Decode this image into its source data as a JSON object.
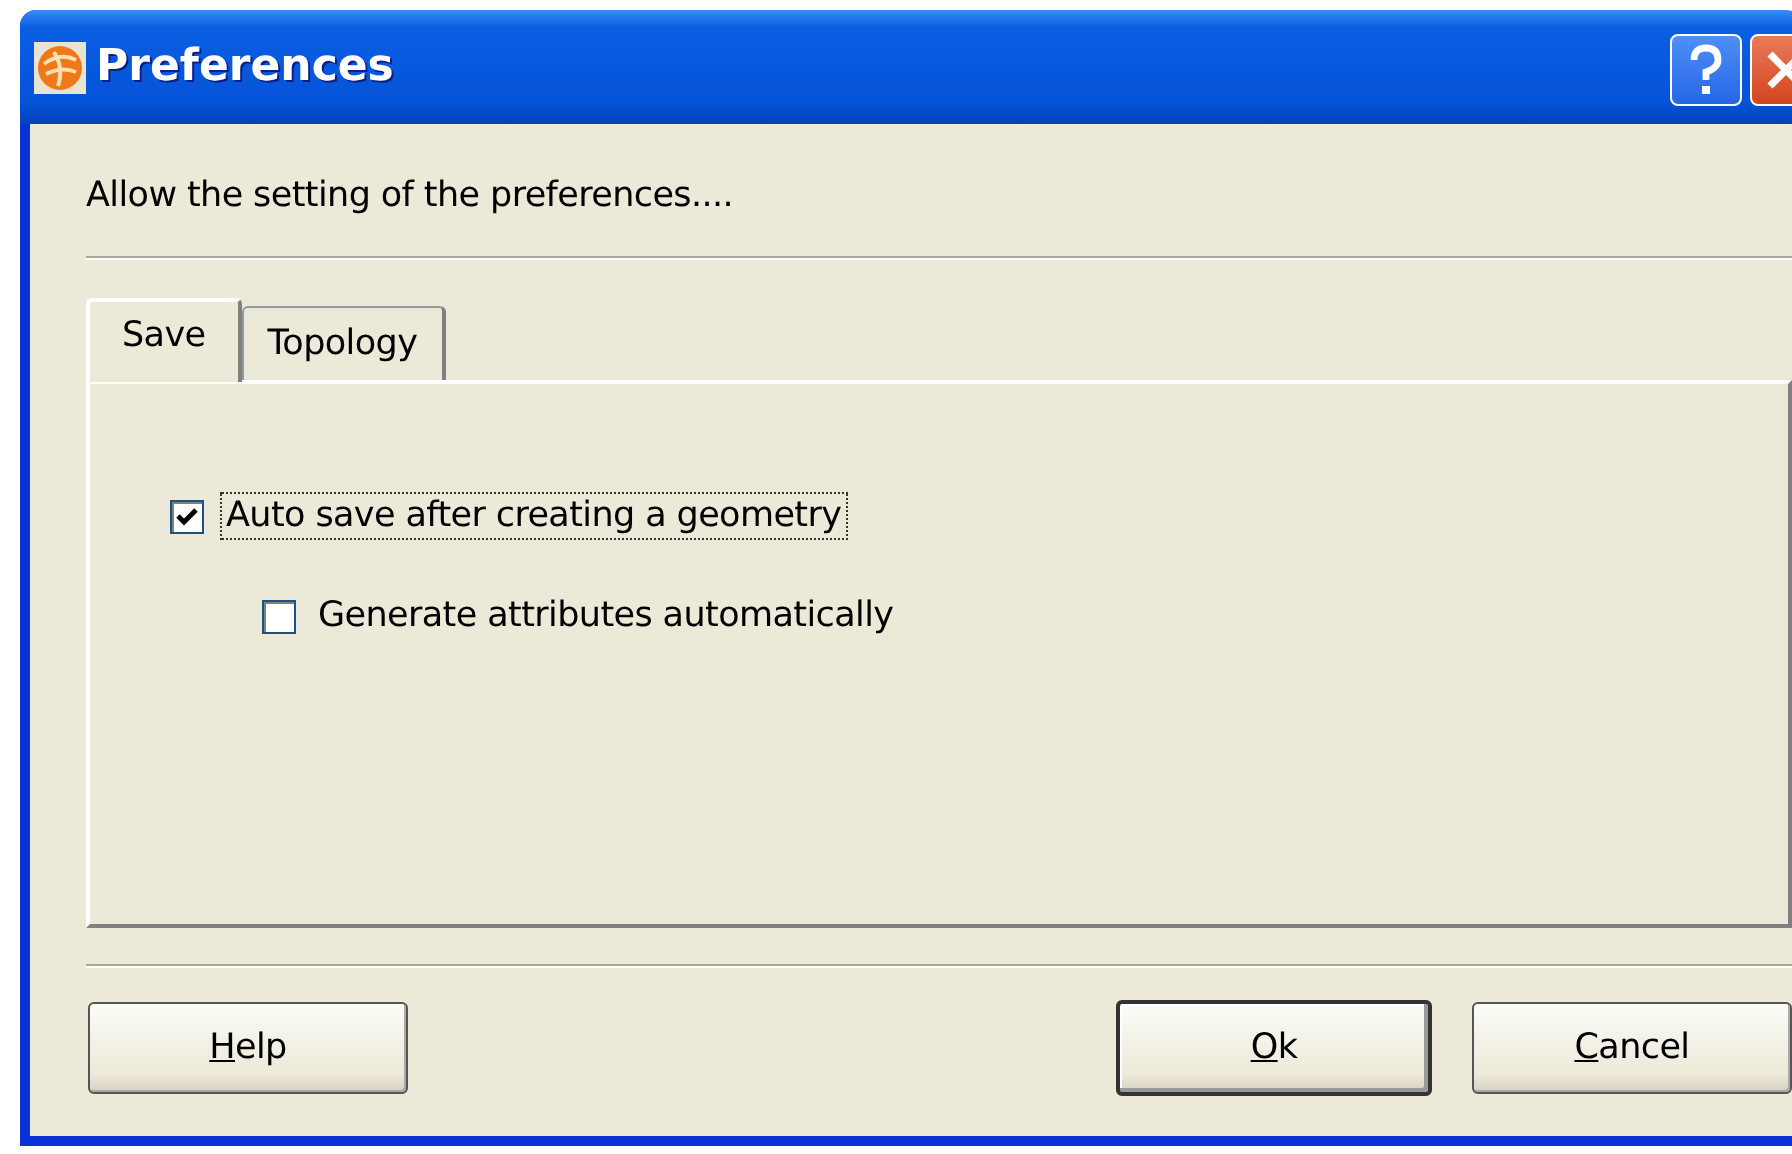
{
  "window": {
    "title": "Preferences"
  },
  "description": "Allow the setting of the preferences....",
  "tabs": [
    {
      "label": "Save",
      "selected": true
    },
    {
      "label": "Topology",
      "selected": false
    }
  ],
  "options": [
    {
      "label": "Auto save after creating a geometry",
      "checked": true,
      "focused": true,
      "children": [
        {
          "label": "Generate attributes automatically",
          "checked": false,
          "focused": false
        }
      ]
    }
  ],
  "buttons": {
    "left": [
      {
        "label": "Help",
        "default": false
      }
    ],
    "right": [
      {
        "label": "Ok",
        "default": true
      },
      {
        "label": "Cancel",
        "default": false
      }
    ]
  }
}
